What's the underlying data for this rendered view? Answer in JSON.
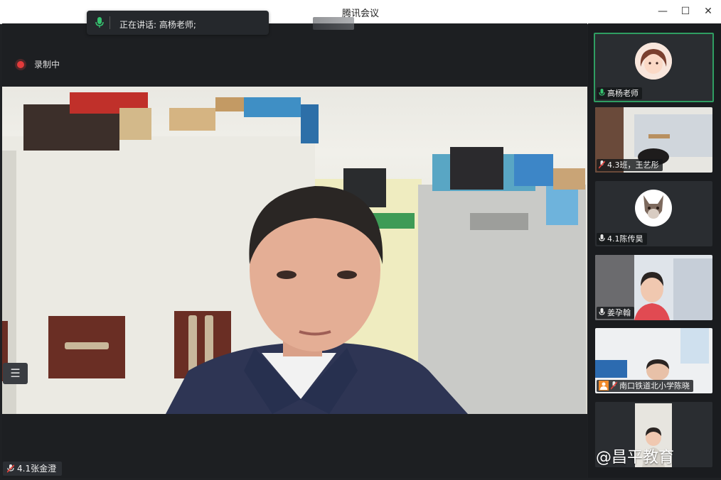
{
  "window": {
    "title": "腾讯会议",
    "minimize": "—",
    "maximize": "☐",
    "close": "✕"
  },
  "banner": {
    "speaking_label": "正在讲话: 高杨老师;"
  },
  "recording": {
    "label": "录制中"
  },
  "main_video": {
    "participant_name": "4.1张金澄"
  },
  "participants": [
    {
      "name": "高杨老师",
      "mic": "on",
      "active": true
    },
    {
      "name": "4.3班，王艺彤",
      "mic": "muted"
    },
    {
      "name": "4.1陈传昊",
      "mic": "on"
    },
    {
      "name": "姜孕翰",
      "mic": "on"
    },
    {
      "name": "南口铁道北小学陈晓",
      "mic": "muted"
    },
    {
      "name": "",
      "mic": ""
    }
  ],
  "watermark": "@昌平教育",
  "icons": {
    "list": "☰"
  }
}
